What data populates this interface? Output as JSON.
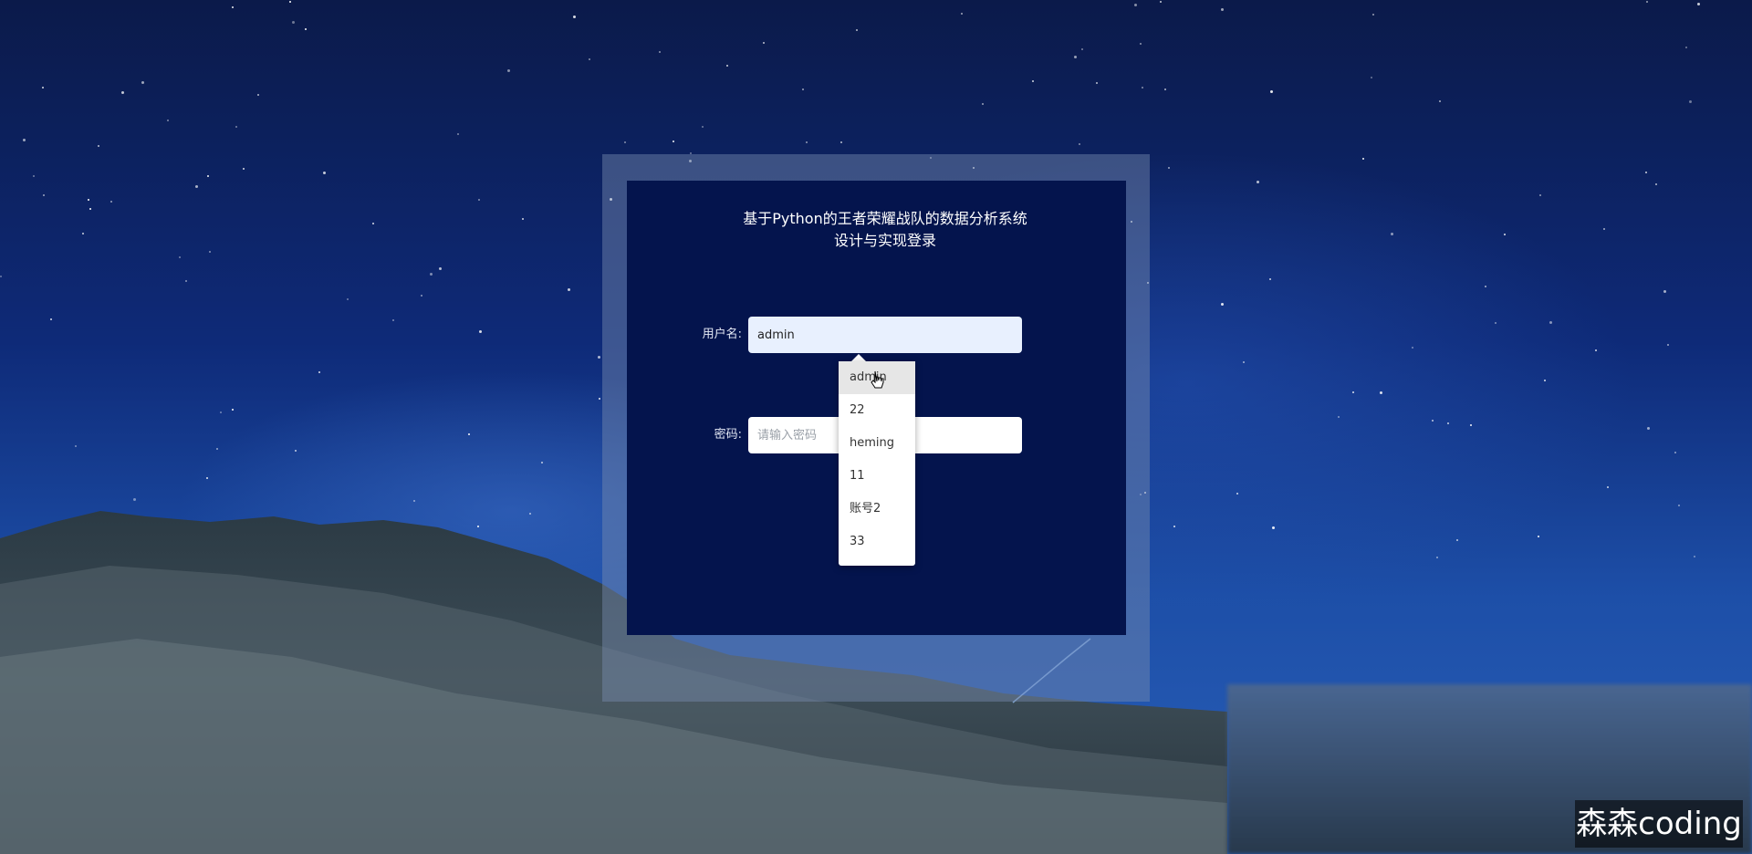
{
  "login": {
    "title": "基于Python的王者荣耀战队的数据分析系统设计与实现登录",
    "username_label": "用户名:",
    "username_value": "admin",
    "password_label": "密码:",
    "password_placeholder": "请输入密码"
  },
  "autocomplete": {
    "items": [
      "admin",
      "22",
      "heming",
      "11",
      "账号2",
      "33"
    ],
    "highlighted_index": 0
  },
  "watermark": {
    "text": "森森coding"
  }
}
